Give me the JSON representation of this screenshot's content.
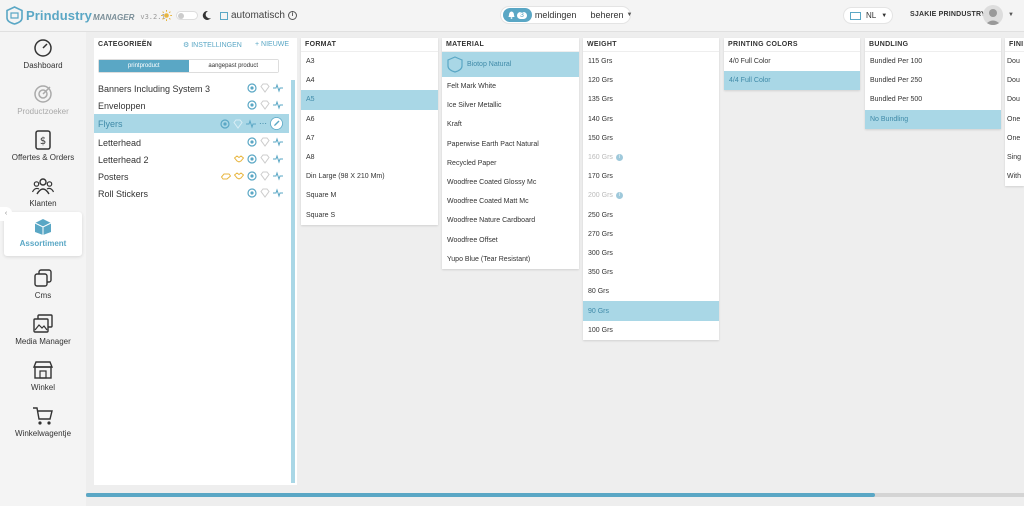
{
  "app": {
    "brand": "Prindustry",
    "brand_sub": "MANAGER",
    "version": "v3.2.1",
    "auto_label": "automatisch",
    "notifications": {
      "count": "3",
      "label": "meldingen"
    },
    "manage_label": "beheren",
    "language": "NL",
    "user_name": "SJAKIE PRINDUSTRY"
  },
  "sidebar": {
    "items": [
      {
        "label": "Dashboard",
        "icon": "speedometer-icon"
      },
      {
        "label": "Productzoeker",
        "icon": "target-icon"
      },
      {
        "label": "Offertes & Orders",
        "icon": "document-dollar-icon"
      },
      {
        "label": "Klanten",
        "icon": "users-icon"
      },
      {
        "label": "Assortiment",
        "icon": "box-icon"
      },
      {
        "label": "Cms",
        "icon": "stack-icon"
      },
      {
        "label": "Media Manager",
        "icon": "images-icon"
      },
      {
        "label": "Winkel",
        "icon": "store-icon"
      },
      {
        "label": "Winkelwagentje",
        "icon": "cart-icon"
      }
    ]
  },
  "categories": {
    "title": "CATEGORIEËN",
    "settings_label": "INSTELLINGEN",
    "new_label": "NIEUWE",
    "tabs": [
      "printproduct",
      "aangepast product"
    ],
    "rows": [
      "Banners Including System 3",
      "Enveloppen",
      "Flyers",
      "Letterhead",
      "Letterhead 2",
      "Posters",
      "Roll Stickers"
    ]
  },
  "columns": {
    "format": {
      "title": "FORMAT",
      "items": [
        "A3",
        "A4",
        "A5",
        "A6",
        "A7",
        "A8",
        "Din Large (98 X 210 Mm)",
        "Square M",
        "Square S"
      ],
      "selected": "A5"
    },
    "material": {
      "title": "MATERIAL",
      "items": [
        "Biotop Natural",
        "Felt Mark White",
        "Ice Silver Metallic",
        "Kraft",
        "Paperwise Earth Pact Natural",
        "Recycled Paper",
        "Woodfree Coated Glossy Mc",
        "Woodfree Coated Matt Mc",
        "Woodfree Nature Cardboard",
        "Woodfree Offset",
        "Yupo Blue (Tear Resistant)"
      ],
      "selected": "Biotop Natural"
    },
    "weight": {
      "title": "WEIGHT",
      "items": [
        "115 Grs",
        "120 Grs",
        "135 Grs",
        "140 Grs",
        "150 Grs",
        "160 Grs",
        "170 Grs",
        "200 Grs",
        "250 Grs",
        "270 Grs",
        "300 Grs",
        "350 Grs",
        "80 Grs",
        "90 Grs",
        "100 Grs"
      ],
      "selected": "90 Grs",
      "disabled": [
        "160 Grs",
        "200 Grs"
      ]
    },
    "printing_colors": {
      "title": "PRINTING COLORS",
      "items": [
        "4/0 Full Color",
        "4/4 Full Color"
      ],
      "selected": "4/4 Full Color"
    },
    "bundling": {
      "title": "BUNDLING",
      "items": [
        "Bundled Per 100",
        "Bundled Per 250",
        "Bundled Per 500",
        "No Bundling"
      ],
      "selected": "No Bundling"
    },
    "finishing": {
      "title": "FINI",
      "items": [
        "Dou",
        "Dou",
        "Dou",
        "One",
        "One",
        "Sing",
        "With"
      ]
    }
  },
  "colors": {
    "accent": "#5aa7c5",
    "selected_bg": "#a9d7e6",
    "warning": "#e8b640"
  },
  "scroll": {
    "horizontal_fraction": 0.84
  }
}
